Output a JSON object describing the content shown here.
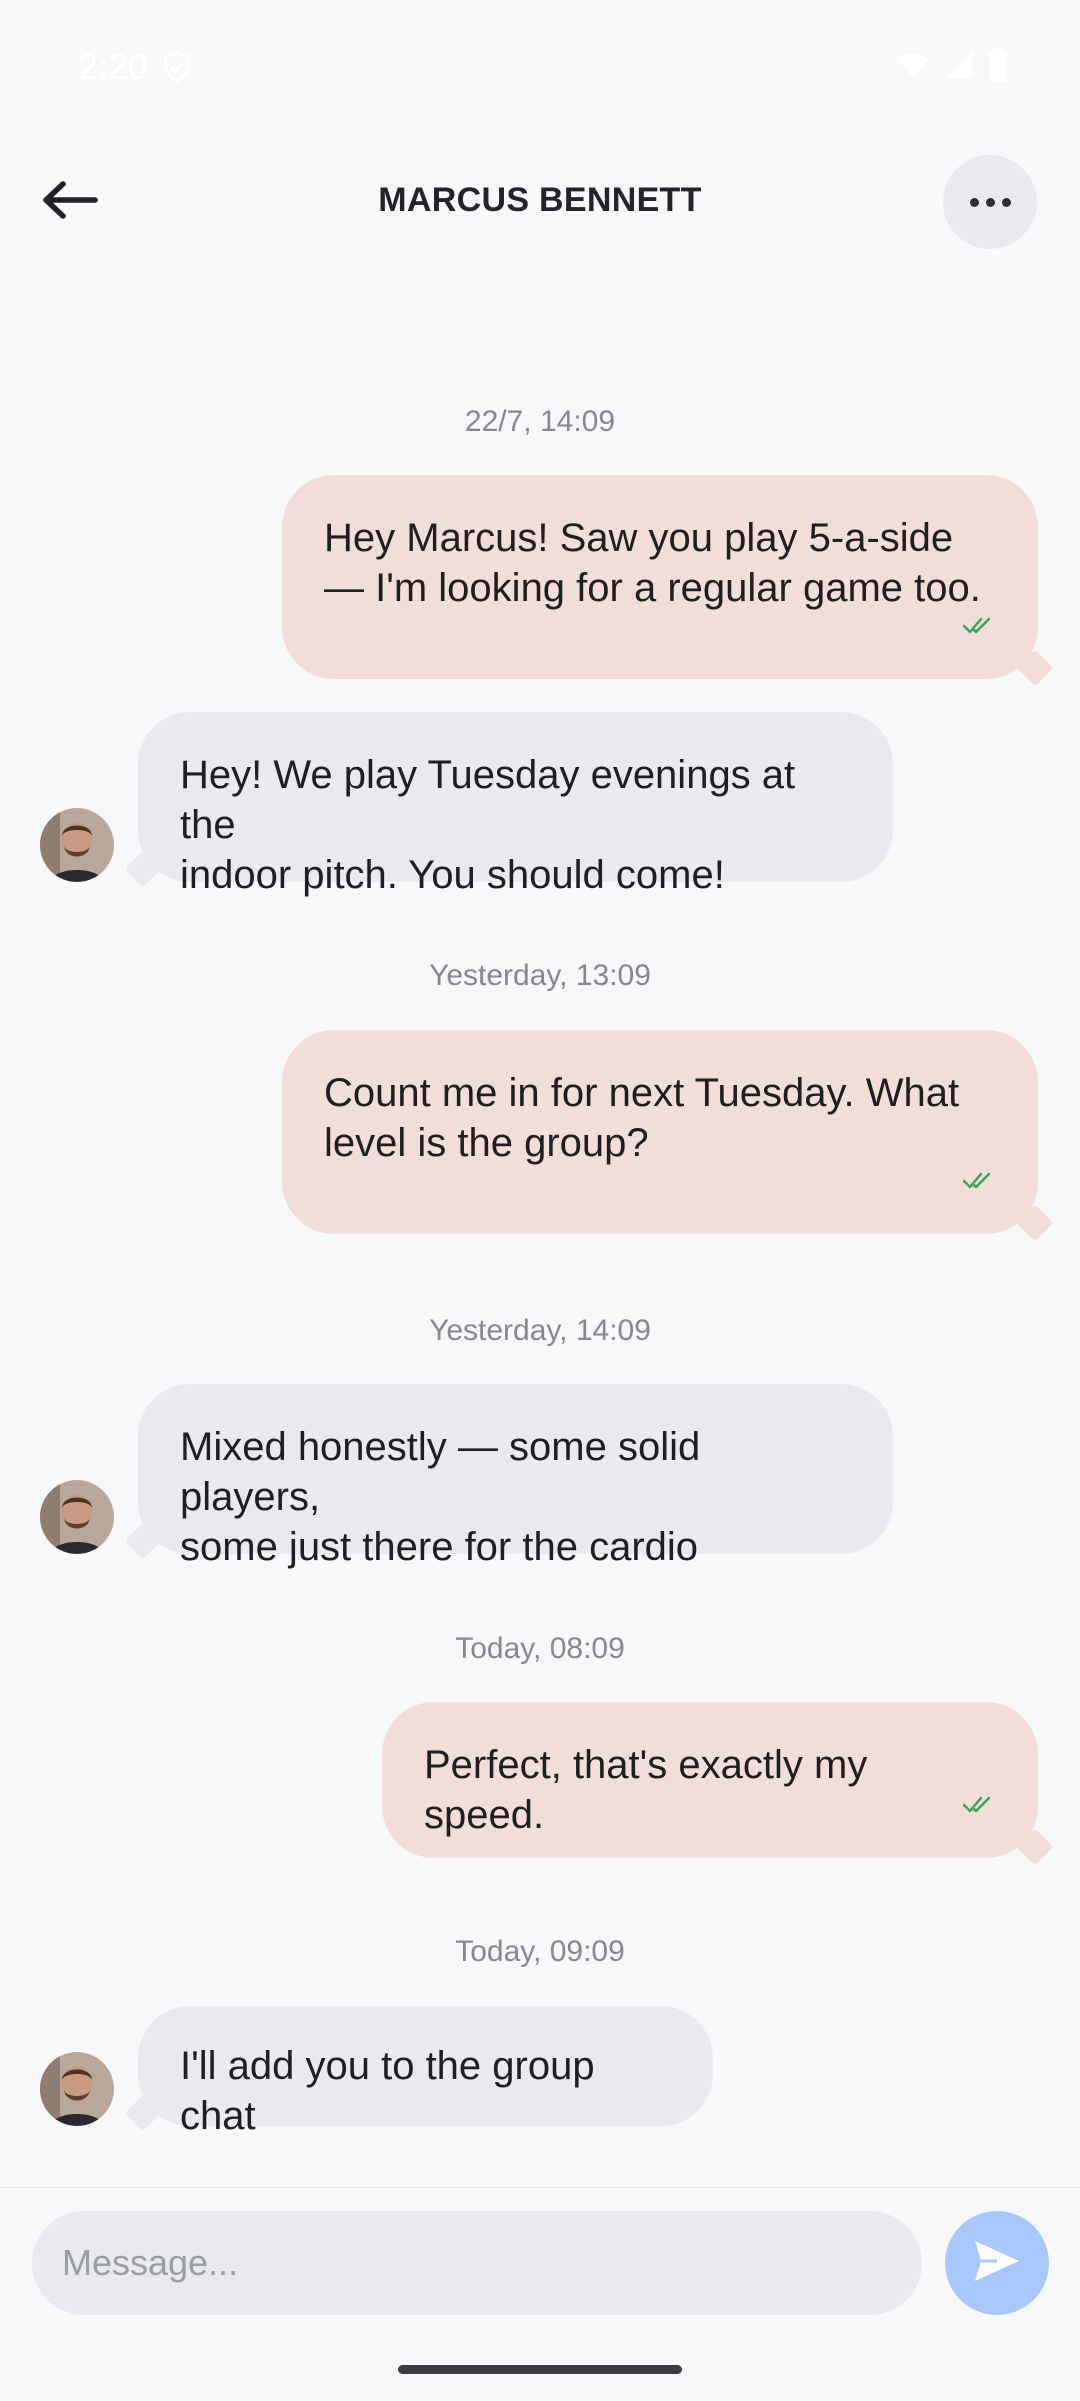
{
  "status": {
    "time": "2:20"
  },
  "header": {
    "title": "MARCUS BENNETT"
  },
  "messages": [
    {
      "timestamp": "22/7, 14:09"
    },
    {
      "text1": "Hey Marcus! Saw you play 5-a-side",
      "text2": "— I'm looking for a regular game too."
    },
    {
      "text1": "Hey! We play Tuesday evenings at the",
      "text2": "indoor pitch. You should come!"
    },
    {
      "timestamp": "Yesterday, 13:09"
    },
    {
      "text1": "Count me in for next Tuesday. What",
      "text2": "level is the group?"
    },
    {
      "timestamp": "Yesterday, 14:09"
    },
    {
      "text1": "Mixed honestly — some solid players,",
      "text2": "some just there for the cardio"
    },
    {
      "timestamp": "Today, 08:09"
    },
    {
      "text1": "Perfect, that's exactly my speed."
    },
    {
      "timestamp": "Today, 09:09"
    },
    {
      "text1": "I'll add you to the group chat"
    }
  ],
  "composer": {
    "placeholder": "Message..."
  },
  "colors": {
    "outgoing_bubble": "#f3ddd8",
    "incoming_bubble": "#e8eaed",
    "send_button": "#a8c7fa",
    "read_check": "#3aa35a"
  },
  "icons": {
    "back": "arrow-left-icon",
    "more": "more-horizontal-icon",
    "read": "double-check-icon",
    "send": "send-icon"
  }
}
